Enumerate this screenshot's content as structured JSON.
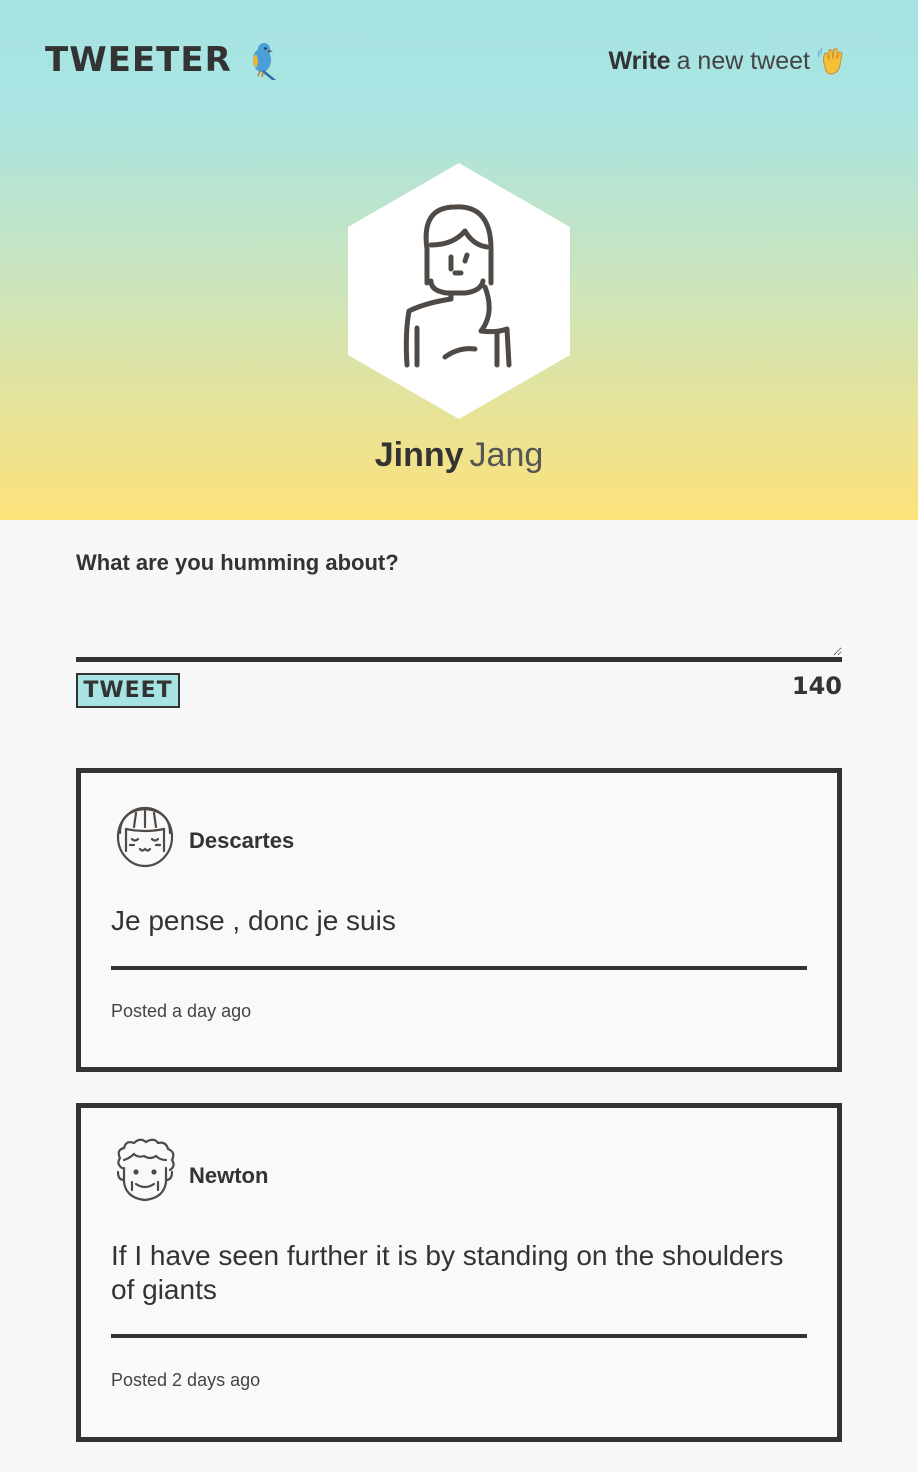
{
  "header": {
    "logo_text": "TWEETER",
    "logo_icon": "bird-icon",
    "write_bold": "Write",
    "write_rest": "a new tweet",
    "write_icon": "waving-hand-icon"
  },
  "profile": {
    "first_name": "Jinny",
    "last_name": "Jang",
    "avatar_icon": "woman-avatar-icon"
  },
  "compose": {
    "prompt": "What are you humming about?",
    "input_value": "",
    "button_label": "TWEET",
    "char_count": "140"
  },
  "tweets": [
    {
      "author": "Descartes",
      "avatar_icon": "girl-bangs-avatar-icon",
      "text": "Je pense , donc je suis",
      "posted": "Posted a day ago"
    },
    {
      "author": "Newton",
      "avatar_icon": "curly-hair-avatar-icon",
      "text": "If I have seen further it is by standing on the shoulders of giants",
      "posted": "Posted 2 days ago"
    }
  ],
  "colors": {
    "accent": "#a7e3e3",
    "gradient_bottom": "#fde27a",
    "ink": "#333333",
    "page_bg": "#f7f7f7"
  }
}
